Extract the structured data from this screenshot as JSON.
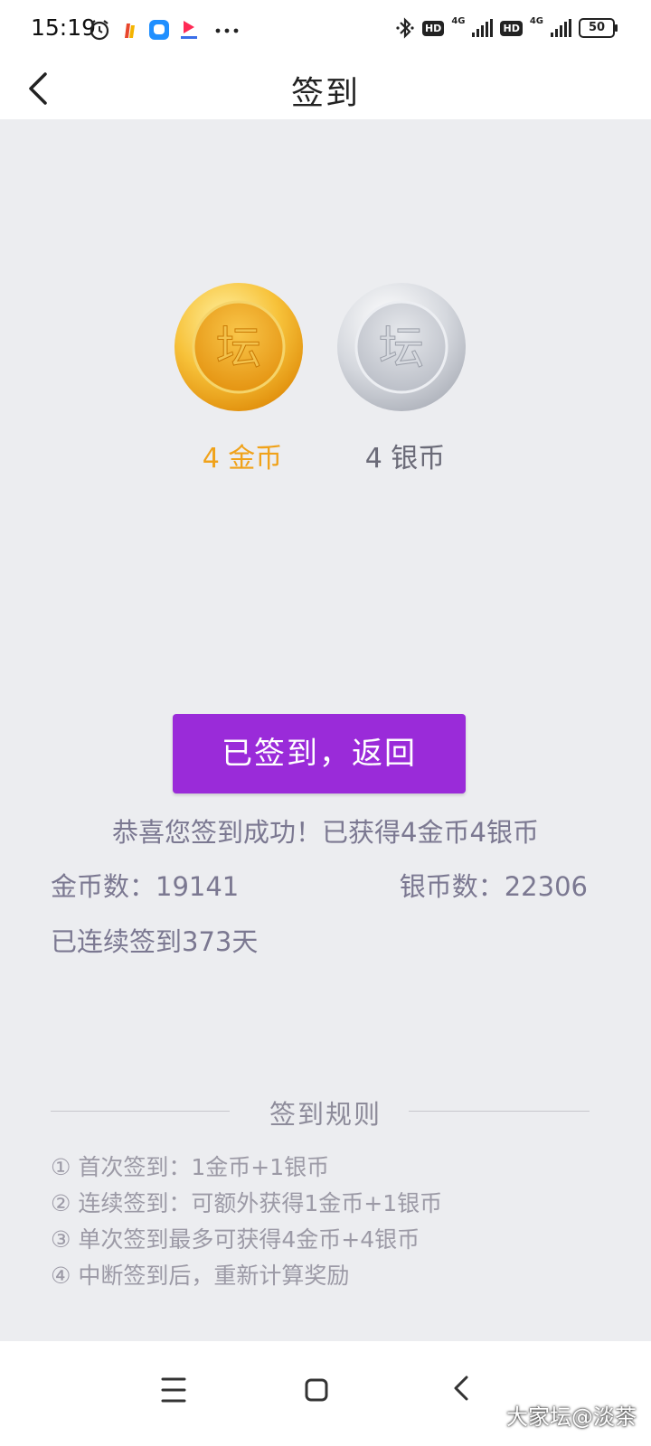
{
  "status_bar": {
    "time": "15:19",
    "hd1": "HD",
    "net1": "4G",
    "hd2": "HD",
    "net2": "4G",
    "battery": "50"
  },
  "header": {
    "title": "签到"
  },
  "coins": {
    "coin_glyph": "坛",
    "gold_label": "4 金币",
    "silver_label": "4 银币",
    "gold_color": "#f0a21a",
    "silver_color": "#6b6b78"
  },
  "action": {
    "button_label": "已签到，返回",
    "button_color": "#9a2bd9"
  },
  "result": {
    "success_message": "恭喜您签到成功！已获得4金币4银币",
    "gold_count": "金币数：19141",
    "silver_count": "银币数：22306",
    "streak": "已连续签到373天"
  },
  "rules": {
    "title": "签到规则",
    "items": [
      "① 首次签到：1金币+1银币",
      "② 连续签到：可额外获得1金币+1银币",
      "③ 单次签到最多可获得4金币+4银币",
      "④ 中断签到后，重新计算奖励"
    ]
  },
  "watermark": "大家坛@淡茶"
}
